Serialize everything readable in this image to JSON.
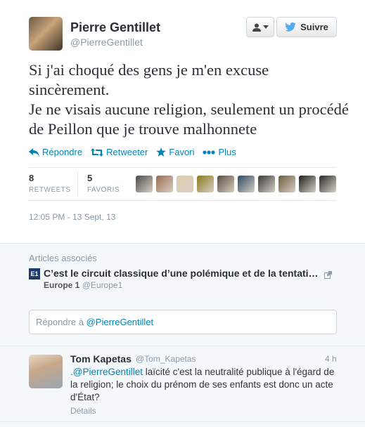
{
  "author": {
    "name": "Pierre Gentillet",
    "handle": "@PierreGentillet"
  },
  "buttons": {
    "follow_label": "Suivre"
  },
  "tweet": {
    "line1": "Si j'ai choqué des gens je m'en excuse sincèrement.",
    "line2": "Je ne visais aucune religion, seulement un procédé de Peillon que je trouve malhonnete"
  },
  "actions": {
    "reply": "Répondre",
    "retweet": "Retweeter",
    "favorite": "Favori",
    "more": "Plus"
  },
  "stats": {
    "retweets": "8",
    "retweets_label": "RETWEETS",
    "favorites": "5",
    "favorites_label": "FAVORIS"
  },
  "timestamp": "12:05 PM - 13 Sept, 13",
  "related": {
    "title": "Articles associés",
    "logo_text": "E1",
    "headline": "C’est le circuit classique d’une polémique et de la tentati…",
    "source_name": "Europe 1",
    "source_handle": "@Europe1"
  },
  "reply_box": {
    "prefix": "Répondre à",
    "mention": "@PierreGentillet"
  },
  "reply": {
    "name": "Tom Kapetas",
    "handle": "@Tom_Kapetas",
    "time": "4 h",
    "mention": ".@PierreGentillet",
    "text": " laïcité c'est la neutralité publique à l'égard de la religion; le choix du prénom de ses enfants est donc un acte d'État?",
    "details": "Détails"
  },
  "colors": {
    "link": "#0084b4",
    "muted": "#8899a6",
    "follow_bird": "#55acee"
  },
  "favoriters": [
    "#4a4a4a",
    "#9c6b52",
    "#e0ccb0",
    "#8a7a1e",
    "#5b4a3e",
    "#2e4a63",
    "#3a3a3a",
    "#6a5a40",
    "#1e1e1e",
    "#2a2a2a"
  ]
}
